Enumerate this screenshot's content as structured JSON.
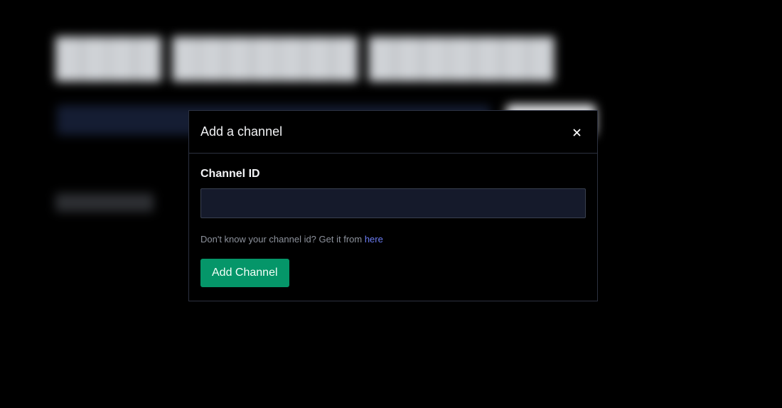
{
  "modal": {
    "title": "Add a channel",
    "close_icon": "close-icon",
    "field_label": "Channel ID",
    "input_value": "",
    "input_placeholder": "",
    "hint_text": "Don't know your channel id? Get it from ",
    "hint_link": "here",
    "submit_label": "Add Channel"
  },
  "colors": {
    "accent": "#059669",
    "link": "#6b7cf2",
    "input_bg": "#151a2b",
    "border": "#2c3140"
  }
}
